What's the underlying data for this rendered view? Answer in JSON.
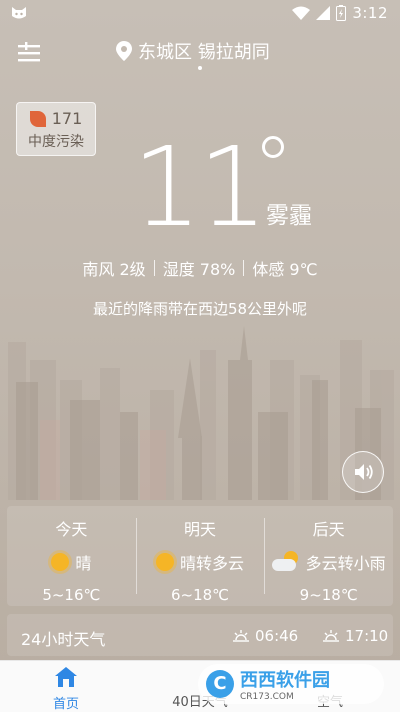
{
  "status": {
    "time": "3:12"
  },
  "header": {
    "location": "东城区 锡拉胡同"
  },
  "aqi": {
    "value": "171",
    "label": "中度污染",
    "color": "#e0653a"
  },
  "current": {
    "temperature": "11",
    "condition": "雾霾",
    "wind": "南风 2级",
    "humidity": "湿度 78%",
    "feels_like": "体感 9℃",
    "rain_note": "最近的降雨带在西边58公里外呢"
  },
  "forecast": [
    {
      "day": "今天",
      "condition": "晴",
      "icon": "sun-icon",
      "temp": "5~16℃"
    },
    {
      "day": "明天",
      "condition": "晴转多云",
      "icon": "sun-icon",
      "temp": "6~18℃"
    },
    {
      "day": "后天",
      "condition": "多云转小雨",
      "icon": "cloud-sun-icon",
      "temp": "9~18℃"
    }
  ],
  "hourly": {
    "title": "24小时天气",
    "sunrise": "06:46",
    "sunset": "17:10"
  },
  "tabs": {
    "home": "首页",
    "forty": "40日天气",
    "air": "空气"
  },
  "watermark": {
    "brand": "西西软件园",
    "url": "CR173.COM"
  },
  "colors": {
    "accent": "#2f87e4",
    "sun": "#f5b526"
  }
}
